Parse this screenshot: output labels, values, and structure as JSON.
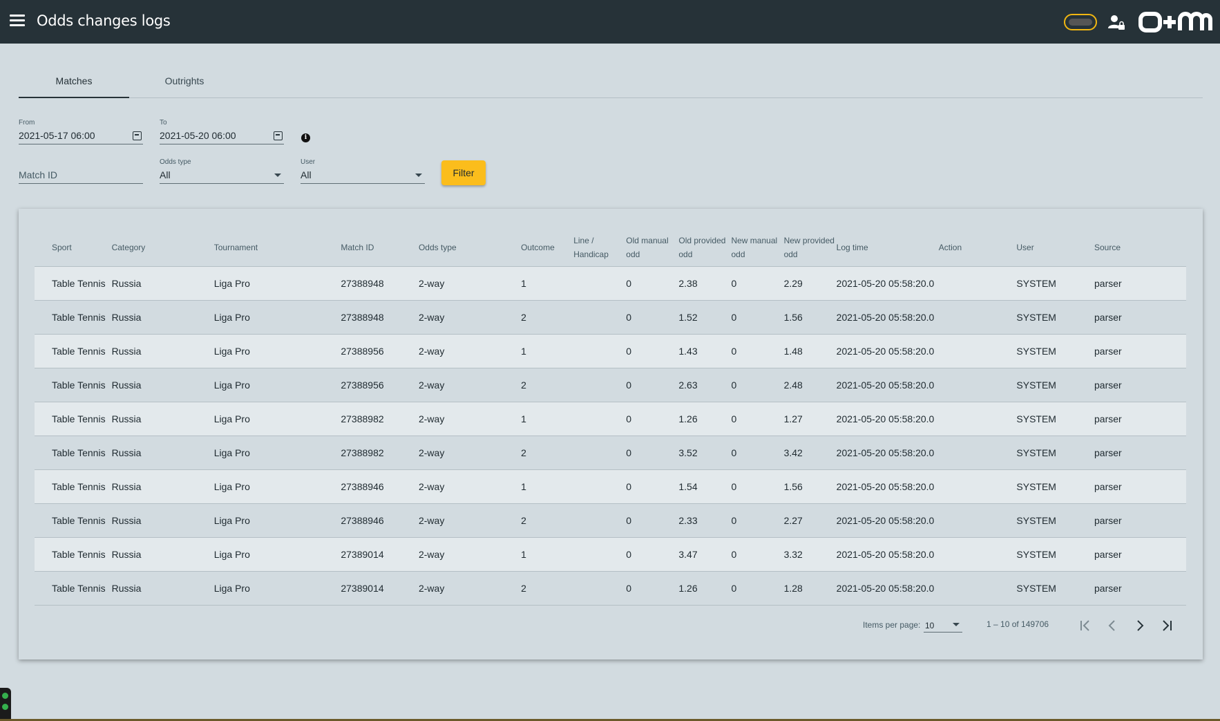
{
  "header": {
    "title": "Odds changes logs",
    "accent_color": "#f2b711",
    "bar_color": "#263238",
    "icons": [
      "menu-icon",
      "toggle-icon",
      "user-lock-icon",
      "logo"
    ]
  },
  "tabs": [
    {
      "label": "Matches",
      "active": true
    },
    {
      "label": "Outrights",
      "active": false
    }
  ],
  "filters": {
    "from_label": "From",
    "from_value": "2021-05-17 06:00",
    "to_label": "To",
    "to_value": "2021-05-20 06:00",
    "match_id_placeholder": "Match ID",
    "odds_type_label": "Odds type",
    "odds_type_value": "All",
    "user_label": "User",
    "user_value": "All",
    "filter_button": "Filter",
    "button_color": "#fbbd1c"
  },
  "table": {
    "columns": [
      "Sport",
      "Category",
      "Tournament",
      "Match ID",
      "Odds type",
      "Outcome",
      "Line / Handicap",
      "Old manual odd",
      "Old provided odd",
      "New manual odd",
      "New provided odd",
      "Log time",
      "Action",
      "User",
      "Source"
    ],
    "rows": [
      [
        "Table Tennis",
        "Russia",
        "Liga Pro",
        "27388948",
        "2-way",
        "1",
        "",
        "0",
        "2.38",
        "0",
        "2.29",
        "2021-05-20 05:58:20.0",
        "",
        "SYSTEM",
        "parser"
      ],
      [
        "Table Tennis",
        "Russia",
        "Liga Pro",
        "27388948",
        "2-way",
        "2",
        "",
        "0",
        "1.52",
        "0",
        "1.56",
        "2021-05-20 05:58:20.0",
        "",
        "SYSTEM",
        "parser"
      ],
      [
        "Table Tennis",
        "Russia",
        "Liga Pro",
        "27388956",
        "2-way",
        "1",
        "",
        "0",
        "1.43",
        "0",
        "1.48",
        "2021-05-20 05:58:20.0",
        "",
        "SYSTEM",
        "parser"
      ],
      [
        "Table Tennis",
        "Russia",
        "Liga Pro",
        "27388956",
        "2-way",
        "2",
        "",
        "0",
        "2.63",
        "0",
        "2.48",
        "2021-05-20 05:58:20.0",
        "",
        "SYSTEM",
        "parser"
      ],
      [
        "Table Tennis",
        "Russia",
        "Liga Pro",
        "27388982",
        "2-way",
        "1",
        "",
        "0",
        "1.26",
        "0",
        "1.27",
        "2021-05-20 05:58:20.0",
        "",
        "SYSTEM",
        "parser"
      ],
      [
        "Table Tennis",
        "Russia",
        "Liga Pro",
        "27388982",
        "2-way",
        "2",
        "",
        "0",
        "3.52",
        "0",
        "3.42",
        "2021-05-20 05:58:20.0",
        "",
        "SYSTEM",
        "parser"
      ],
      [
        "Table Tennis",
        "Russia",
        "Liga Pro",
        "27388946",
        "2-way",
        "1",
        "",
        "0",
        "1.54",
        "0",
        "1.56",
        "2021-05-20 05:58:20.0",
        "",
        "SYSTEM",
        "parser"
      ],
      [
        "Table Tennis",
        "Russia",
        "Liga Pro",
        "27388946",
        "2-way",
        "2",
        "",
        "0",
        "2.33",
        "0",
        "2.27",
        "2021-05-20 05:58:20.0",
        "",
        "SYSTEM",
        "parser"
      ],
      [
        "Table Tennis",
        "Russia",
        "Liga Pro",
        "27389014",
        "2-way",
        "1",
        "",
        "0",
        "3.47",
        "0",
        "3.32",
        "2021-05-20 05:58:20.0",
        "",
        "SYSTEM",
        "parser"
      ],
      [
        "Table Tennis",
        "Russia",
        "Liga Pro",
        "27389014",
        "2-way",
        "2",
        "",
        "0",
        "1.26",
        "0",
        "1.28",
        "2021-05-20 05:58:20.0",
        "",
        "SYSTEM",
        "parser"
      ]
    ]
  },
  "paginator": {
    "items_per_page_label": "Items per page:",
    "items_per_page_value": "10",
    "range_label": "1 – 10 of 149706"
  }
}
